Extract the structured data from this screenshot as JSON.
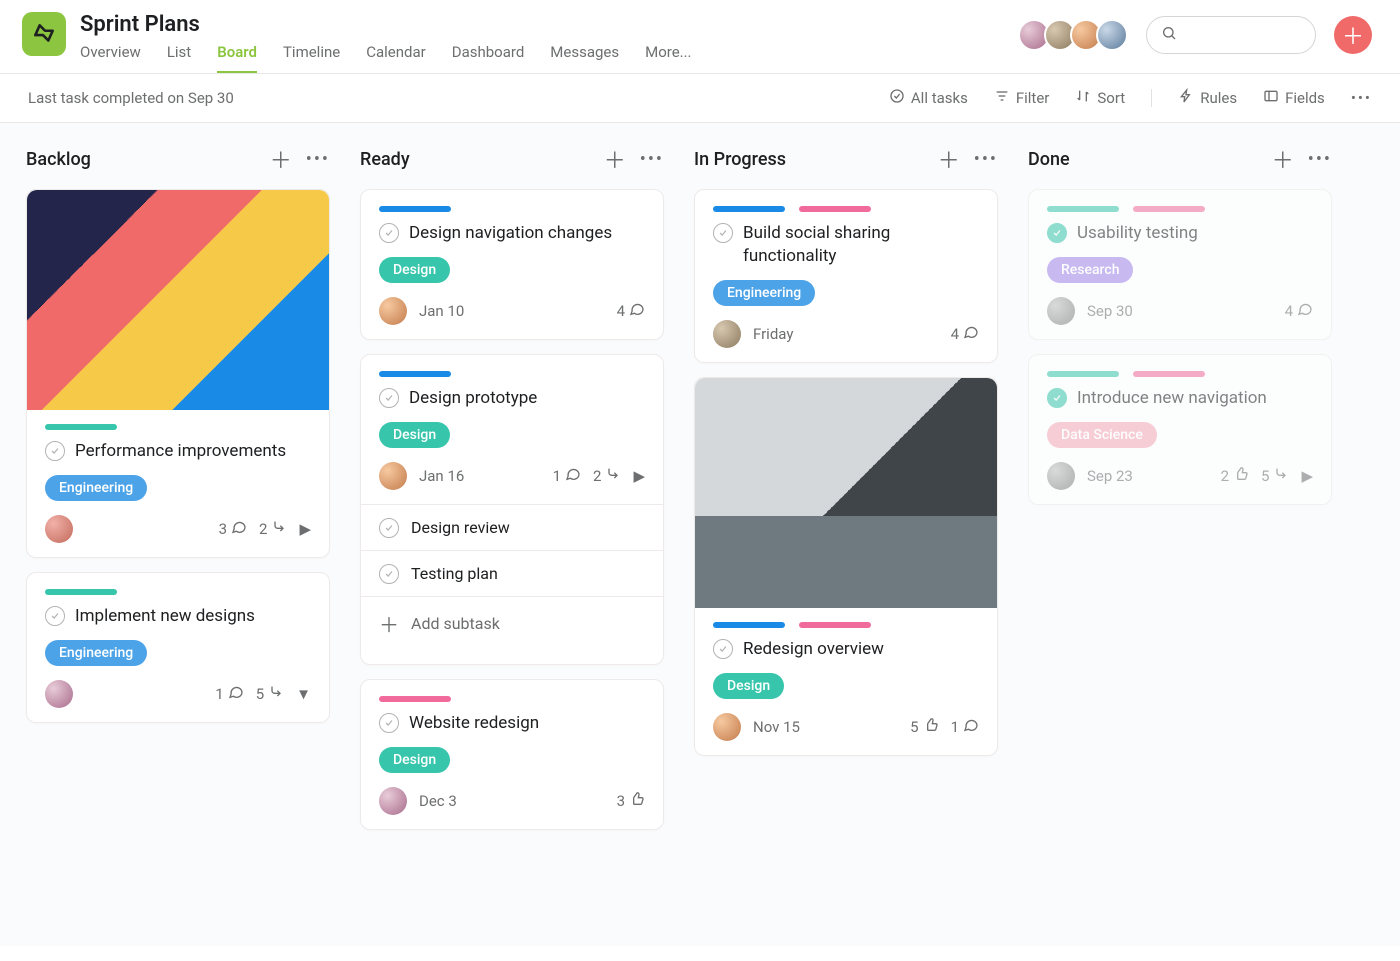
{
  "project": {
    "title": "Sprint Plans",
    "tabs": [
      "Overview",
      "List",
      "Board",
      "Timeline",
      "Calendar",
      "Dashboard",
      "Messages",
      "More..."
    ],
    "active_tab": "Board"
  },
  "toolbar": {
    "status": "Last task completed on Sep 30",
    "all_tasks": "All tasks",
    "filter": "Filter",
    "sort": "Sort",
    "rules": "Rules",
    "fields": "Fields"
  },
  "columns": [
    {
      "title": "Backlog",
      "cards": [
        {
          "cover": "pattern",
          "stripes": [
            "teal"
          ],
          "title": "Performance improvements",
          "pill": {
            "label": "Engineering",
            "class": "pill-eng"
          },
          "assignee": "av-e",
          "due": "",
          "meta": {
            "comments": 3,
            "subtasks": 2,
            "likes": 0,
            "arrow": "right"
          }
        },
        {
          "stripes": [
            "teal"
          ],
          "title": "Implement new designs",
          "pill": {
            "label": "Engineering",
            "class": "pill-eng"
          },
          "assignee": "av-d",
          "due": "",
          "meta": {
            "comments": 1,
            "subtasks": 5,
            "likes": 0,
            "arrow": "down"
          }
        }
      ]
    },
    {
      "title": "Ready",
      "cards": [
        {
          "stripes": [
            "blue"
          ],
          "title": "Design navigation changes",
          "pill": {
            "label": "Design",
            "class": "pill-des"
          },
          "assignee": "av-a",
          "due": "Jan 10",
          "meta": {
            "comments": 4,
            "subtasks": 0,
            "likes": 0
          }
        },
        {
          "stripes": [
            "blue"
          ],
          "title": "Design prototype",
          "pill": {
            "label": "Design",
            "class": "pill-des"
          },
          "assignee": "av-a",
          "due": "Jan 16",
          "meta": {
            "comments": 1,
            "subtasks": 2,
            "likes": 0,
            "arrow": "right"
          },
          "subtasks": [
            "Design review",
            "Testing plan"
          ],
          "add_label": "Add subtask"
        },
        {
          "stripes": [
            "pink"
          ],
          "title": "Website redesign",
          "pill": {
            "label": "Design",
            "class": "pill-des"
          },
          "assignee": "av-d",
          "due": "Dec 3",
          "meta": {
            "comments": 0,
            "subtasks": 0,
            "likes": 3
          }
        }
      ]
    },
    {
      "title": "In Progress",
      "cards": [
        {
          "stripes": [
            "blue",
            "pink"
          ],
          "title": "Build social sharing functionality",
          "pill": {
            "label": "Engineering",
            "class": "pill-eng"
          },
          "assignee": "av-b",
          "due": "Friday",
          "meta": {
            "comments": 4,
            "subtasks": 0,
            "likes": 0
          }
        },
        {
          "cover": "mountain",
          "stripes": [
            "blue",
            "pink"
          ],
          "title": "Redesign overview",
          "pill": {
            "label": "Design",
            "class": "pill-des"
          },
          "assignee": "av-a",
          "due": "Nov 15",
          "meta": {
            "comments": 1,
            "subtasks": 0,
            "likes": 5
          }
        }
      ]
    },
    {
      "title": "Done",
      "cards": [
        {
          "done": true,
          "stripes": [
            "teal",
            "pink"
          ],
          "title": "Usability testing",
          "pill": {
            "label": "Research",
            "class": "pill-res"
          },
          "assignee": "av-f",
          "due": "Sep 30",
          "meta": {
            "comments": 4,
            "subtasks": 0,
            "likes": 0
          }
        },
        {
          "done": true,
          "stripes": [
            "teal",
            "pink"
          ],
          "title": "Introduce new navigation",
          "pill": {
            "label": "Data Science",
            "class": "pill-ds"
          },
          "assignee": "av-f",
          "due": "Sep 23",
          "meta": {
            "comments": 0,
            "subtasks": 5,
            "likes": 2,
            "arrow": "right"
          }
        }
      ]
    }
  ]
}
